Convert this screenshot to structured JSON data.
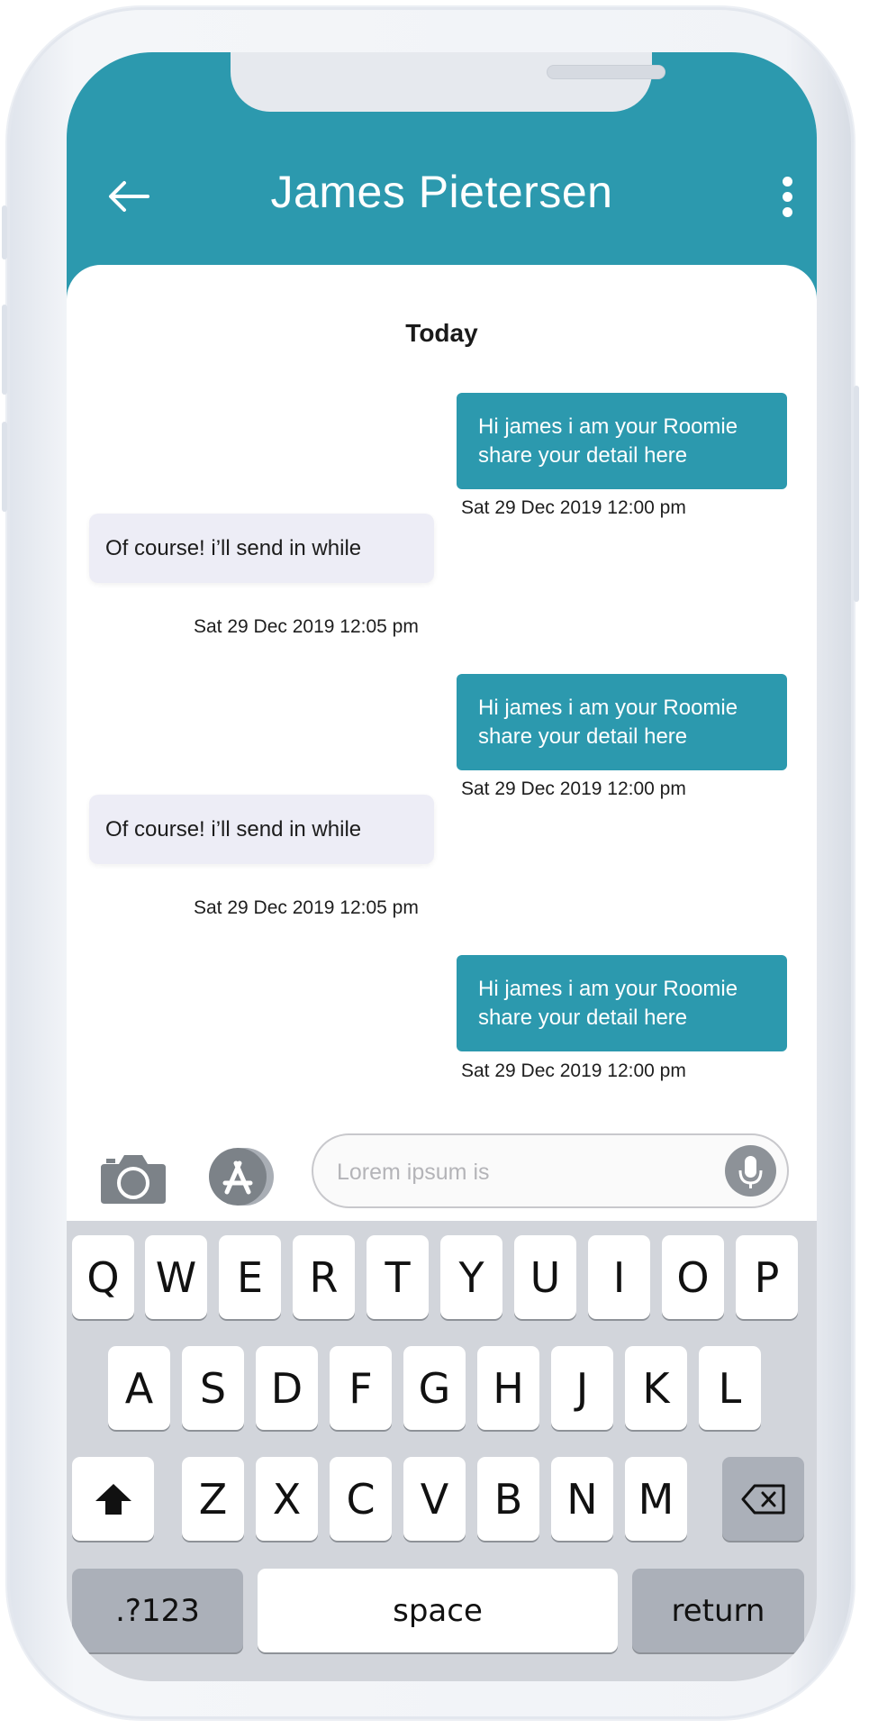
{
  "header": {
    "title": "James Pietersen",
    "back_icon": "arrow-left-icon",
    "menu_icon": "more-vertical-icon",
    "color": "#2c99ae"
  },
  "chat": {
    "day_label": "Today",
    "messages": [
      {
        "direction": "sent",
        "text": "Hi james i am your Roomie share your detail here",
        "time": "Sat 29 Dec 2019 12:00 pm"
      },
      {
        "direction": "received",
        "text": "Of course! i’ll send in while",
        "time": "Sat 29 Dec 2019 12:05 pm"
      },
      {
        "direction": "sent",
        "text": "Hi james i am your Roomie share your detail here",
        "time": "Sat 29 Dec 2019 12:00 pm"
      },
      {
        "direction": "received",
        "text": "Of course! i’ll send in while",
        "time": "Sat 29 Dec 2019 12:05 pm"
      },
      {
        "direction": "sent",
        "text": "Hi james i am your Roomie share your detail here",
        "time": "Sat 29 Dec 2019 12:00 pm"
      }
    ]
  },
  "composer": {
    "placeholder": "Lorem ipsum is",
    "camera_icon": "camera-icon",
    "apps_icon": "app-store-icon",
    "mic_icon": "microphone-icon"
  },
  "keyboard": {
    "row1": [
      "Q",
      "W",
      "E",
      "R",
      "T",
      "Y",
      "U",
      "I",
      "O",
      "P"
    ],
    "row2": [
      "A",
      "S",
      "D",
      "F",
      "G",
      "H",
      "J",
      "K",
      "L"
    ],
    "row3": [
      "Z",
      "X",
      "C",
      "V",
      "B",
      "N",
      "M"
    ],
    "shift_icon": "shift-arrow-icon",
    "backspace_icon": "backspace-icon",
    "numbers_label": ".?123",
    "space_label": "space",
    "return_label": "return"
  }
}
